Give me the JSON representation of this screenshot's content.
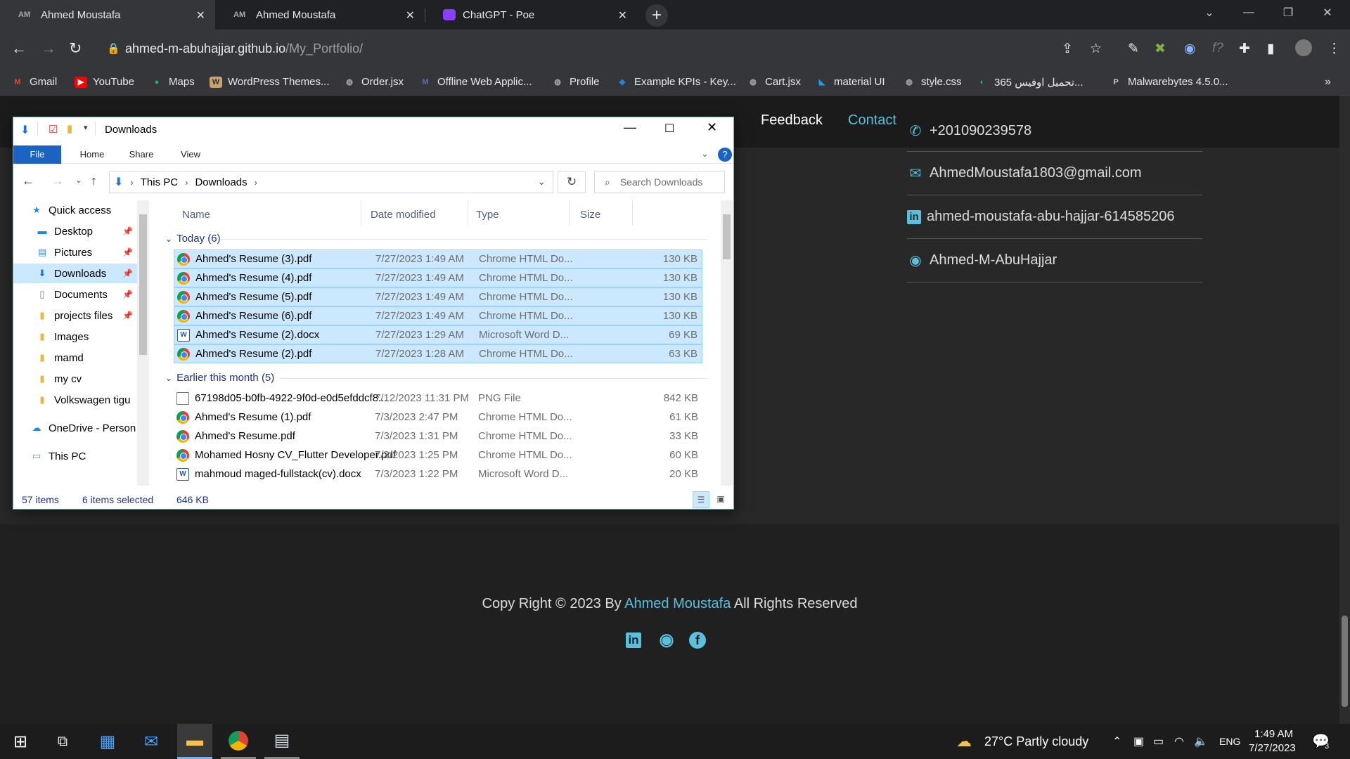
{
  "browser": {
    "tabs": [
      {
        "title": "Ahmed Moustafa",
        "favicon": "AM",
        "active": true
      },
      {
        "title": "Ahmed Moustafa",
        "favicon": "AM",
        "active": false
      },
      {
        "title": "ChatGPT - Poe",
        "favicon": "poe-icon",
        "active": false
      }
    ],
    "url_host": "ahmed-m-abuhajjar.github.io",
    "url_path": "/My_Portfolio/",
    "bookmarks": [
      "Gmail",
      "YouTube",
      "Maps",
      "WordPress Themes...",
      "Order.jsx",
      "Offline Web Applic...",
      "Profile",
      "Example KPIs - Key...",
      "Cart.jsx",
      "material UI",
      "style.css",
      "تحميل اوفيس 365...",
      "Malwarebytes 4.5.0..."
    ]
  },
  "webpage": {
    "nav": [
      "Feedback",
      "Contact"
    ],
    "contacts": [
      {
        "icon": "phone-icon",
        "text": "+201090239578"
      },
      {
        "icon": "email-icon",
        "text": "AhmedMoustafa1803@gmail.com"
      },
      {
        "icon": "linkedin-icon",
        "text": "ahmed-moustafa-abu-hajjar-614585206"
      },
      {
        "icon": "github-icon",
        "text": "Ahmed-M-AbuHajjar"
      }
    ],
    "copyright_prefix": "Copy Right © 2023 By ",
    "copyright_name": "Ahmed Moustafa",
    "copyright_suffix": " All Rights Reserved",
    "accent": "#5bc0de"
  },
  "explorer": {
    "title": "Downloads",
    "ribbon_tabs": [
      "File",
      "Home",
      "Share",
      "View"
    ],
    "breadcrumb": [
      "This PC",
      "Downloads"
    ],
    "search_placeholder": "Search Downloads",
    "nav_items": [
      {
        "label": "Quick access",
        "icon": "star-icon",
        "pinned": false
      },
      {
        "label": "Desktop",
        "icon": "desktop-icon",
        "pinned": true
      },
      {
        "label": "Pictures",
        "icon": "pictures-icon",
        "pinned": true
      },
      {
        "label": "Downloads",
        "icon": "download-icon",
        "pinned": true,
        "selected": true
      },
      {
        "label": "Documents",
        "icon": "documents-icon",
        "pinned": true
      },
      {
        "label": "projects files",
        "icon": "folder-icon",
        "pinned": true
      },
      {
        "label": "Images",
        "icon": "folder-icon",
        "pinned": false
      },
      {
        "label": "mamd",
        "icon": "folder-icon",
        "pinned": false
      },
      {
        "label": "my cv",
        "icon": "folder-icon",
        "pinned": false
      },
      {
        "label": "Volkswagen tigu",
        "icon": "folder-icon",
        "pinned": false
      },
      {
        "label": "OneDrive - Person",
        "icon": "onedrive-icon",
        "pinned": false
      },
      {
        "label": "This PC",
        "icon": "pc-icon",
        "pinned": false
      }
    ],
    "columns": [
      "Name",
      "Date modified",
      "Type",
      "Size"
    ],
    "groups": [
      {
        "label": "Today (6)",
        "files": [
          {
            "name": "Ahmed's Resume (3).pdf",
            "date": "7/27/2023 1:49 AM",
            "type": "Chrome HTML Do...",
            "size": "130 KB",
            "icon": "chrome",
            "selected": true
          },
          {
            "name": "Ahmed's Resume (4).pdf",
            "date": "7/27/2023 1:49 AM",
            "type": "Chrome HTML Do...",
            "size": "130 KB",
            "icon": "chrome",
            "selected": true
          },
          {
            "name": "Ahmed's Resume (5).pdf",
            "date": "7/27/2023 1:49 AM",
            "type": "Chrome HTML Do...",
            "size": "130 KB",
            "icon": "chrome",
            "selected": true
          },
          {
            "name": "Ahmed's Resume (6).pdf",
            "date": "7/27/2023 1:49 AM",
            "type": "Chrome HTML Do...",
            "size": "130 KB",
            "icon": "chrome",
            "selected": true
          },
          {
            "name": "Ahmed's Resume (2).docx",
            "date": "7/27/2023 1:29 AM",
            "type": "Microsoft Word D...",
            "size": "69 KB",
            "icon": "word",
            "selected": true
          },
          {
            "name": "Ahmed's Resume (2).pdf",
            "date": "7/27/2023 1:28 AM",
            "type": "Chrome HTML Do...",
            "size": "63 KB",
            "icon": "chrome",
            "selected": true
          }
        ]
      },
      {
        "label": "Earlier this month (5)",
        "files": [
          {
            "name": "67198d05-b0fb-4922-9f0d-e0d5efddcf8...",
            "date": "7/12/2023 11:31 PM",
            "type": "PNG File",
            "size": "842 KB",
            "icon": "png",
            "selected": false
          },
          {
            "name": "Ahmed's Resume (1).pdf",
            "date": "7/3/2023 2:47 PM",
            "type": "Chrome HTML Do...",
            "size": "61 KB",
            "icon": "chrome",
            "selected": false
          },
          {
            "name": "Ahmed's Resume.pdf",
            "date": "7/3/2023 1:31 PM",
            "type": "Chrome HTML Do...",
            "size": "33 KB",
            "icon": "chrome",
            "selected": false
          },
          {
            "name": "Mohamed Hosny CV_Flutter Developer.pdf",
            "date": "7/3/2023 1:25 PM",
            "type": "Chrome HTML Do...",
            "size": "60 KB",
            "icon": "chrome",
            "selected": false
          },
          {
            "name": "mahmoud maged-fullstack(cv).docx",
            "date": "7/3/2023 1:22 PM",
            "type": "Microsoft Word D...",
            "size": "20 KB",
            "icon": "word",
            "selected": false
          }
        ]
      }
    ],
    "status": {
      "items": "57 items",
      "selected": "6 items selected",
      "size": "646 KB"
    }
  },
  "taskbar": {
    "weather": "27°C  Partly cloudy",
    "lang": "ENG",
    "time": "1:49 AM",
    "date": "7/27/2023",
    "notifications": "3"
  }
}
